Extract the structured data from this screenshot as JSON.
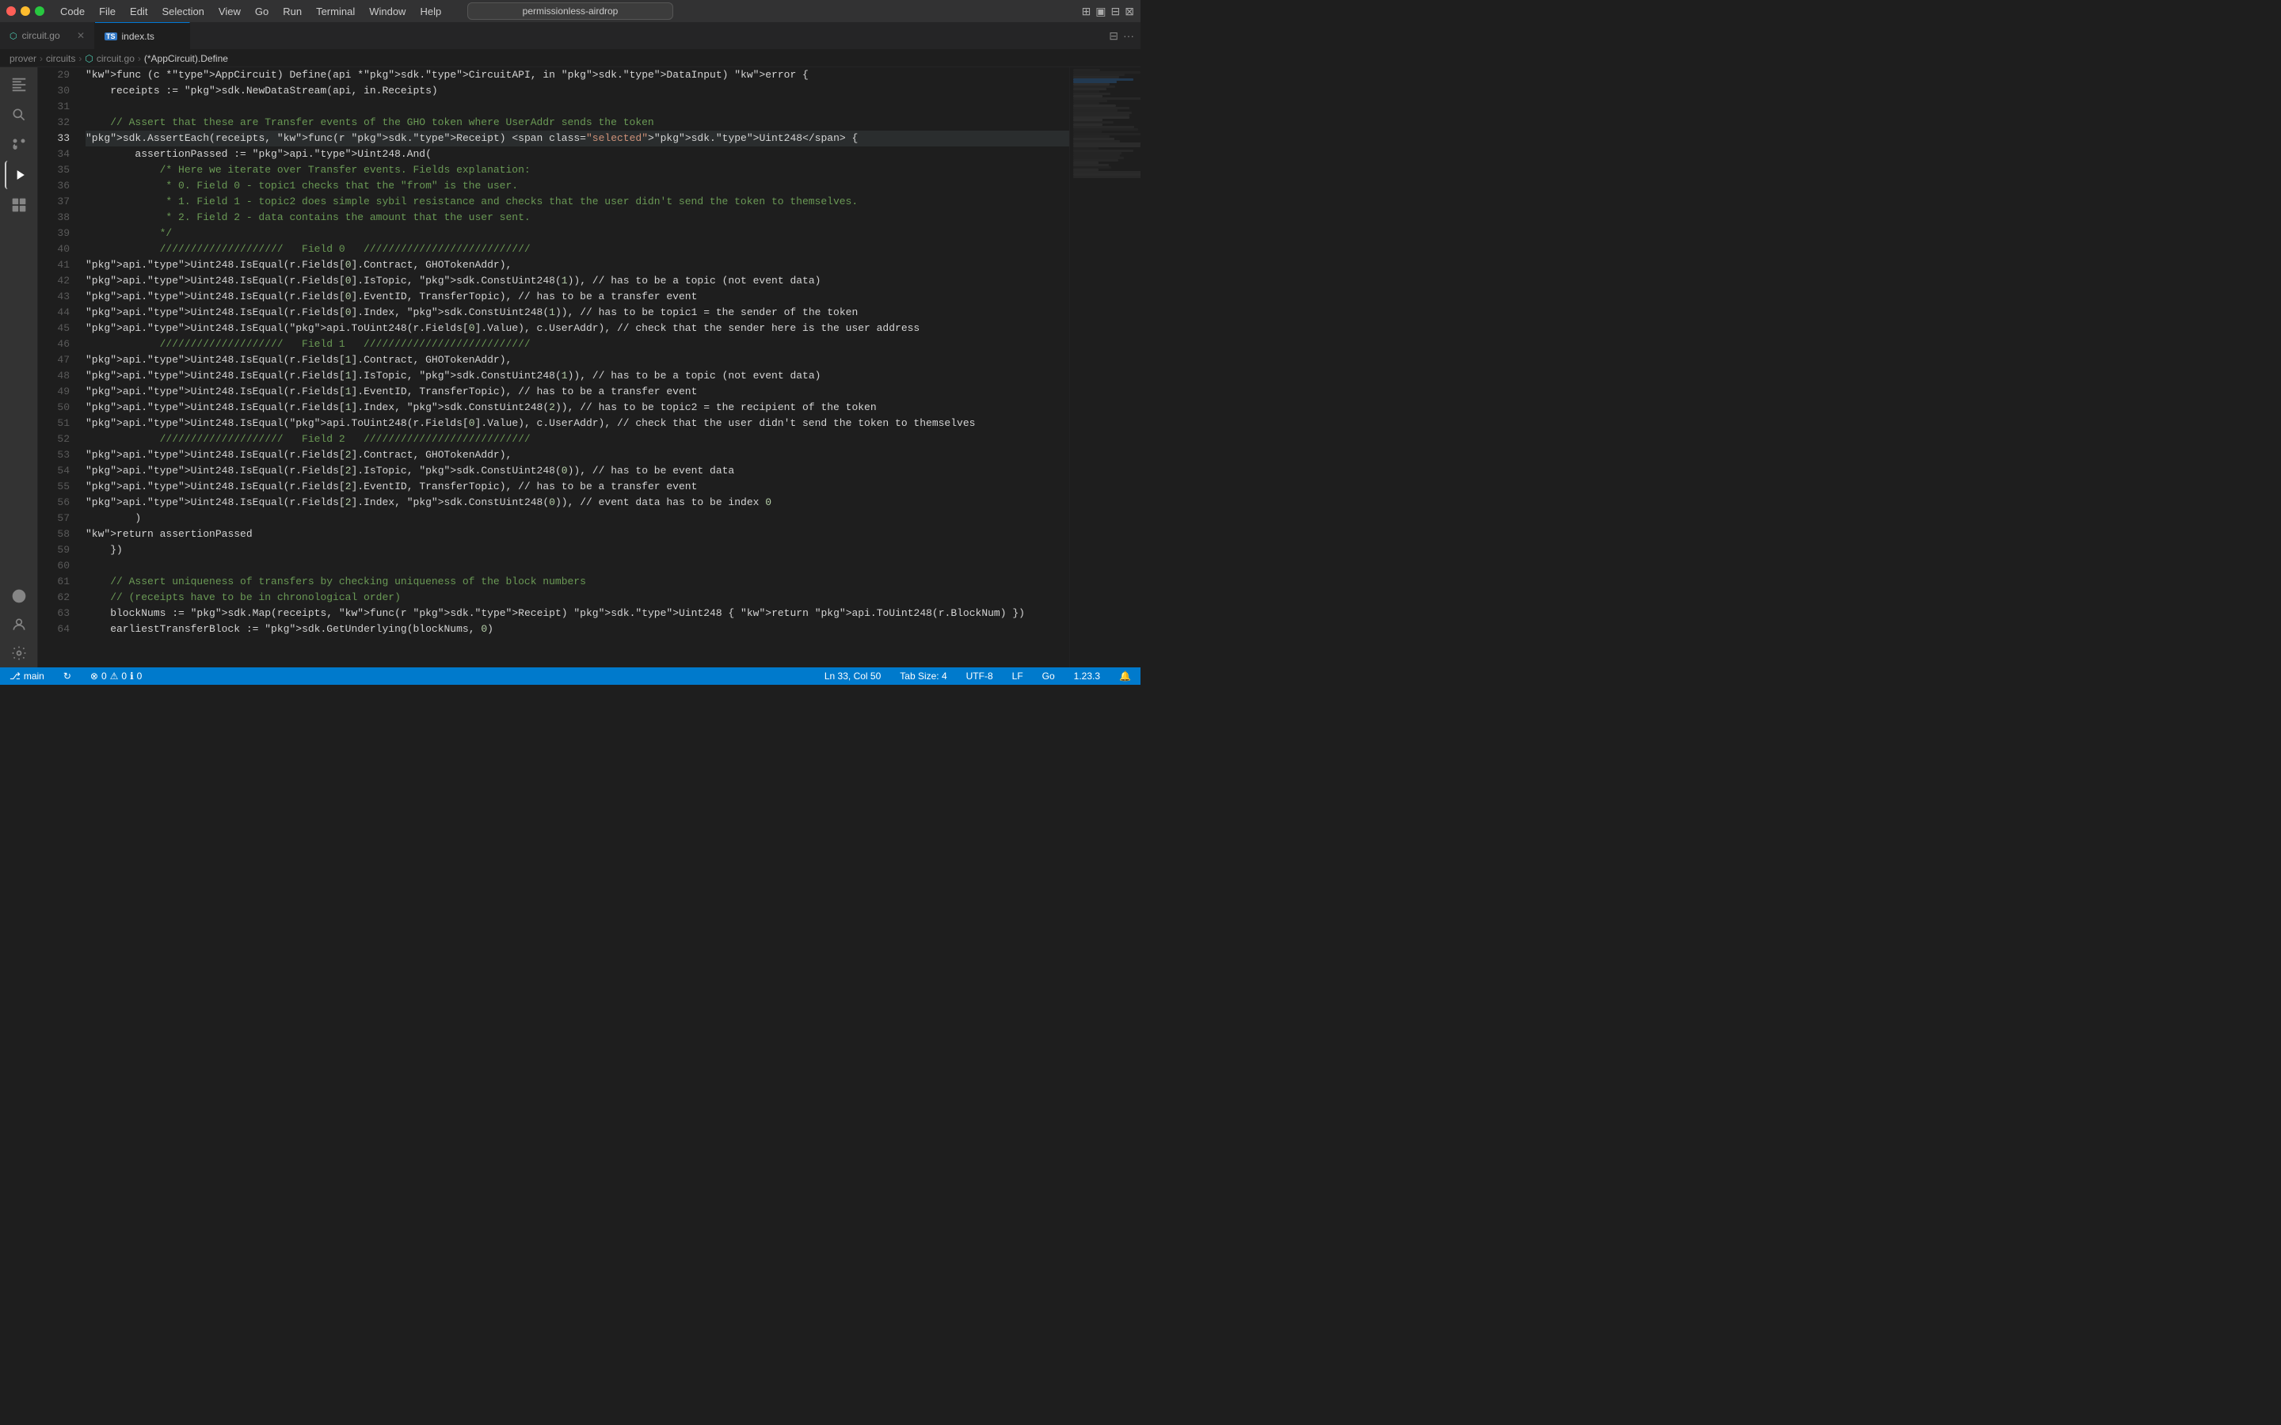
{
  "titlebar": {
    "traffic": [
      "close",
      "minimize",
      "maximize"
    ],
    "menu_items": [
      "Code",
      "File",
      "Edit",
      "Selection",
      "View",
      "Go",
      "Run",
      "Terminal",
      "Window",
      "Help"
    ],
    "search_placeholder": "permissionless-airdrop"
  },
  "tabs": [
    {
      "id": "circuit-go",
      "label": "circuit.go",
      "icon": "⬡",
      "active": false,
      "closeable": true
    },
    {
      "id": "index-ts",
      "label": "index.ts",
      "icon": "TS",
      "active": true,
      "closeable": false
    }
  ],
  "breadcrumb": [
    "prover",
    "circuits",
    "circuit.go",
    "(*AppCircuit).Define"
  ],
  "activity_icons": [
    "files",
    "search",
    "source-control",
    "run-debug",
    "extensions",
    "remote"
  ],
  "code": {
    "lines": [
      {
        "num": 29,
        "content": "func (c *AppCircuit) Define(api *sdk.CircuitAPI, in sdk.DataInput) error {"
      },
      {
        "num": 30,
        "content": "\treceipts := sdk.NewDataStream(api, in.Receipts)"
      },
      {
        "num": 31,
        "content": ""
      },
      {
        "num": 32,
        "content": "\t// Assert that these are Transfer events of the GHO token where UserAddr sends the token"
      },
      {
        "num": 33,
        "content": "\tsdk.AssertEach(receipts, func(r sdk.Receipt) sdk.Uint248 {"
      },
      {
        "num": 34,
        "content": "\t\tassertionPassed := api.Uint248.And("
      },
      {
        "num": 35,
        "content": "\t\t\t/* Here we iterate over Transfer events. Fields explanation:"
      },
      {
        "num": 36,
        "content": "\t\t\t * 0. Field 0 - topic1 checks that the \"from\" is the user."
      },
      {
        "num": 37,
        "content": "\t\t\t * 1. Field 1 - topic2 does simple sybil resistance and checks that the user didn't send the token to themselves."
      },
      {
        "num": 38,
        "content": "\t\t\t * 2. Field 2 - data contains the amount that the user sent."
      },
      {
        "num": 39,
        "content": "\t\t\t*/"
      },
      {
        "num": 40,
        "content": "\t\t\t////////////////////   Field 0   ///////////////////////////"
      },
      {
        "num": 41,
        "content": "\t\t\tapi.Uint248.IsEqual(r.Fields[0].Contract, GHOTokenAddr),"
      },
      {
        "num": 42,
        "content": "\t\t\tapi.Uint248.IsEqual(r.Fields[0].IsTopic, sdk.ConstUint248(1)), // has to be a topic (not event data)"
      },
      {
        "num": 43,
        "content": "\t\t\tapi.Uint248.IsEqual(r.Fields[0].EventID, TransferTopic), // has to be a transfer event"
      },
      {
        "num": 44,
        "content": "\t\t\tapi.Uint248.IsEqual(r.Fields[0].Index, sdk.ConstUint248(1)), // has to be topic1 = the sender of the token"
      },
      {
        "num": 45,
        "content": "\t\t\tapi.Uint248.IsEqual(api.ToUint248(r.Fields[0].Value), c.UserAddr), // check that the sender here is the user address"
      },
      {
        "num": 46,
        "content": "\t\t\t////////////////////   Field 1   ///////////////////////////"
      },
      {
        "num": 47,
        "content": "\t\t\tapi.Uint248.IsEqual(r.Fields[1].Contract, GHOTokenAddr),"
      },
      {
        "num": 48,
        "content": "\t\t\tapi.Uint248.IsEqual(r.Fields[1].IsTopic, sdk.ConstUint248(1)), // has to be a topic (not event data)"
      },
      {
        "num": 49,
        "content": "\t\t\tapi.Uint248.IsEqual(r.Fields[1].EventID, TransferTopic), // has to be a transfer event"
      },
      {
        "num": 50,
        "content": "\t\t\tapi.Uint248.IsEqual(r.Fields[1].Index, sdk.ConstUint248(2)), // has to be topic2 = the recipient of the token"
      },
      {
        "num": 51,
        "content": "\t\t\tapi.Uint248.IsEqual(api.ToUint248(r.Fields[0].Value), c.UserAddr), // check that the user didn't send the token to themselves"
      },
      {
        "num": 52,
        "content": "\t\t\t////////////////////   Field 2   ///////////////////////////"
      },
      {
        "num": 53,
        "content": "\t\t\tapi.Uint248.IsEqual(r.Fields[2].Contract, GHOTokenAddr),"
      },
      {
        "num": 54,
        "content": "\t\t\tapi.Uint248.IsEqual(r.Fields[2].IsTopic, sdk.ConstUint248(0)), // has to be event data"
      },
      {
        "num": 55,
        "content": "\t\t\tapi.Uint248.IsEqual(r.Fields[2].EventID, TransferTopic), // has to be a transfer event"
      },
      {
        "num": 56,
        "content": "\t\t\tapi.Uint248.IsEqual(r.Fields[2].Index, sdk.ConstUint248(0)), // event data has to be index 0"
      },
      {
        "num": 57,
        "content": "\t\t)"
      },
      {
        "num": 58,
        "content": "\t\treturn assertionPassed"
      },
      {
        "num": 59,
        "content": "\t})"
      },
      {
        "num": 60,
        "content": ""
      },
      {
        "num": 61,
        "content": "\t// Assert uniqueness of transfers by checking uniqueness of the block numbers"
      },
      {
        "num": 62,
        "content": "\t// (receipts have to be in chronological order)"
      },
      {
        "num": 63,
        "content": "\tblockNums := sdk.Map(receipts, func(r sdk.Receipt) sdk.Uint248 { return api.ToUint248(r.BlockNum) })"
      },
      {
        "num": 64,
        "content": "\tearliestTransferBlock := sdk.GetUnderlying(blockNums, 0)"
      }
    ],
    "active_line": 33,
    "cursor_pos": "Ln 33, Col 50"
  },
  "status_bar": {
    "branch": "main",
    "errors": "0",
    "warnings": "0",
    "info": "0",
    "cursor": "Ln 33, Col 50",
    "tab_size": "Tab Size: 4",
    "encoding": "UTF-8",
    "line_ending": "LF",
    "language": "Go",
    "version": "1.23.3"
  }
}
